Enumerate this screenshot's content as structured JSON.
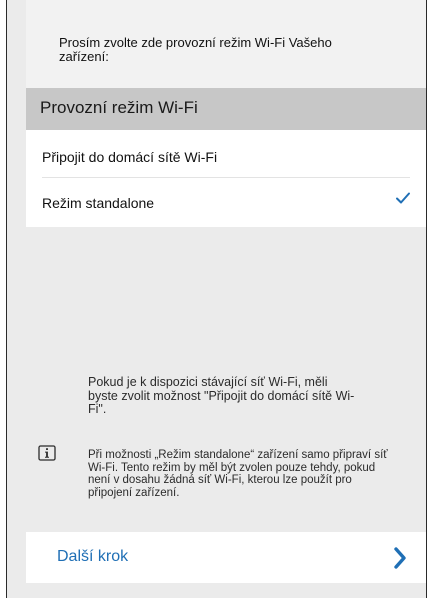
{
  "intro": {
    "text": "Prosím zvolte zde provozní režim Wi-Fi Vašeho zařízení:"
  },
  "section_header": {
    "title": "Provozní režim Wi-Fi"
  },
  "options": [
    {
      "label": "Připojit do domácí sítě Wi-Fi",
      "selected": false
    },
    {
      "label": "Režim standalone",
      "selected": true
    }
  ],
  "info": {
    "paragraph_1": "Pokud je k dispozici stávající síť Wi-Fi, měli byste zvolit možnost \"Připojit do domácí sítě Wi-Fi\".",
    "paragraph_2": "Při možnosti „Režim standalone“ zařízení samo připraví síť Wi-Fi. Tento režim by měl být zvolen pouze tehdy, pokud není v dosahu žádná síť Wi-Fi, kterou lze použít pro připojení zařízení.",
    "icon": "info-icon"
  },
  "next": {
    "label": "Další krok",
    "icon": "chevron-right-icon"
  },
  "colors": {
    "accent": "#1f6fb5",
    "background": "#ebebeb",
    "header": "#c7c7c7",
    "intro": "#f2f2f2"
  }
}
